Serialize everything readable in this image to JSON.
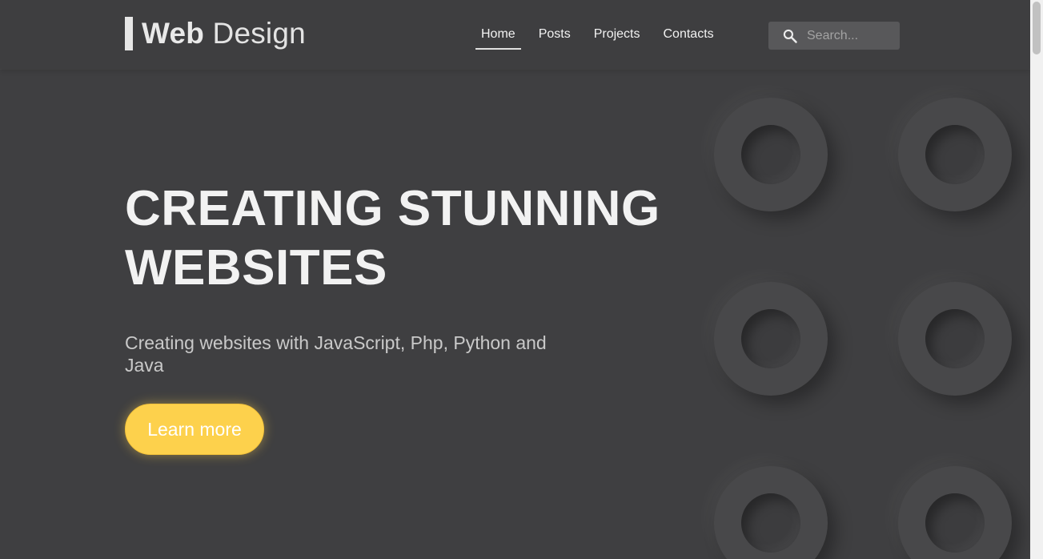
{
  "brand": {
    "bold": "Web",
    "light": "Design"
  },
  "nav": {
    "items": [
      {
        "label": "Home",
        "active": true
      },
      {
        "label": "Posts"
      },
      {
        "label": "Projects"
      },
      {
        "label": "Contacts"
      }
    ]
  },
  "search": {
    "placeholder": "Search...",
    "value": "",
    "icon": "search-icon"
  },
  "hero": {
    "title_line1": "CREATING STUNNING",
    "title_line2": "WEBSITES",
    "subtitle": "Creating websites with JavaScript, Php, Python and Java",
    "cta_label": "Learn more"
  },
  "colors": {
    "background": "#3f3f41",
    "header": "#3e3e40",
    "accent": "#fdd14c",
    "text": "#f2f2f2"
  }
}
